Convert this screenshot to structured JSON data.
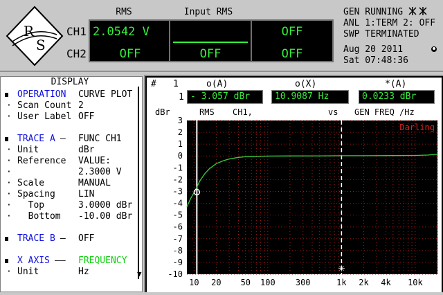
{
  "logo_text": "R&S",
  "channels": {
    "ch1": "CH1",
    "ch2": "CH2"
  },
  "columns": [
    {
      "header": "RMS",
      "ch1": "2.0542  V",
      "ch2": "OFF"
    },
    {
      "header": "Input RMS",
      "ch1": "",
      "ch2": "OFF"
    },
    {
      "header": "",
      "ch1": "OFF",
      "ch2": "OFF"
    }
  ],
  "status": {
    "gen": "GEN RUNNING",
    "anl": "ANL 1:TERM 2: OFF",
    "swp": "SWP TERMINATED",
    "date": "Aug 20 2011",
    "time": "Sat 07:48:36"
  },
  "panel": {
    "title": "DISPLAY",
    "rows": [
      {
        "bullet": true,
        "label": "OPERATION",
        "value": "CURVE PLOT",
        "label_color": "blue"
      },
      {
        "bullet": false,
        "label": "Scan Count",
        "value": "2"
      },
      {
        "bullet": false,
        "label": "User Label",
        "value": "OFF"
      },
      {
        "bullet": true,
        "label": "TRACE A",
        "sep": "—",
        "value": "FUNC CH1",
        "label_color": "blue"
      },
      {
        "bullet": false,
        "label": "Unit",
        "value": "dBr"
      },
      {
        "bullet": false,
        "label": "Reference",
        "value": "VALUE:"
      },
      {
        "bullet": false,
        "label": "",
        "value": "2.3000 V"
      },
      {
        "bullet": false,
        "label": "Scale",
        "value": "MANUAL"
      },
      {
        "bullet": false,
        "label": "Spacing",
        "value": "LIN"
      },
      {
        "bullet": false,
        "label": "  Top",
        "value": "3.0000 dBr"
      },
      {
        "bullet": false,
        "label": "  Bottom",
        "value": "-10.00 dBr"
      },
      {
        "bullet": true,
        "label": "TRACE B",
        "sep": "—",
        "value": "OFF",
        "label_color": "blue"
      },
      {
        "bullet": true,
        "label": "X AXIS",
        "sep": "——",
        "value": "FREQUENCY",
        "label_color": "blue",
        "value_color": "green"
      },
      {
        "bullet": false,
        "label": "Unit",
        "value": "Hz"
      }
    ]
  },
  "graph": {
    "hash": "#",
    "col1": "1",
    "hdr_a": "o(A)",
    "hdr_x": "o(X)",
    "hdr_star": "*(A)",
    "row_num": "1",
    "val_a": "- 3.057 dBr",
    "val_x": "10.9087  Hz",
    "val_star": "0.0233 dBr",
    "ylabel": "dBr",
    "rms_label": "RMS",
    "ch_label": "CH1,",
    "vs_label": "vs",
    "xlabel": "GEN FREQ /Hz",
    "darling": "Darling"
  },
  "chart_data": {
    "type": "line",
    "x_scale": "log",
    "xlim": [
      8,
      20000
    ],
    "ylim": [
      -10,
      3
    ],
    "y_ticks": [
      "3",
      "2",
      "1",
      "0",
      "-1",
      "-2",
      "-3",
      "-4",
      "-5",
      "-6",
      "-7",
      "-8",
      "-9",
      "-10"
    ],
    "x_ticks": [
      {
        "value": 10,
        "label": "10"
      },
      {
        "value": 20,
        "label": "20"
      },
      {
        "value": 50,
        "label": "50"
      },
      {
        "value": 100,
        "label": "100"
      },
      {
        "value": 300,
        "label": "300"
      },
      {
        "value": 1000,
        "label": "1k"
      },
      {
        "value": 2000,
        "label": "2k"
      },
      {
        "value": 4000,
        "label": "4k"
      },
      {
        "value": 10000,
        "label": "10k"
      }
    ],
    "series": [
      {
        "color": "#34d03c",
        "x": [
          8,
          9,
          10,
          11,
          12,
          14,
          16,
          20,
          25,
          30,
          40,
          50,
          70,
          100,
          200,
          500,
          1000,
          2000,
          5000,
          10000,
          15000,
          20000
        ],
        "y": [
          -4.3,
          -3.6,
          -3.1,
          -2.6,
          -2.1,
          -1.5,
          -1.1,
          -0.65,
          -0.4,
          -0.25,
          -0.12,
          -0.06,
          -0.03,
          -0.01,
          0.0,
          0.01,
          0.02,
          0.02,
          0.03,
          0.04,
          0.08,
          0.15
        ]
      }
    ],
    "cursor_a": {
      "x": 10.9087,
      "y": -3.057
    },
    "cursor_star": {
      "x": 1000,
      "y": 0.0233
    },
    "grid": true
  }
}
